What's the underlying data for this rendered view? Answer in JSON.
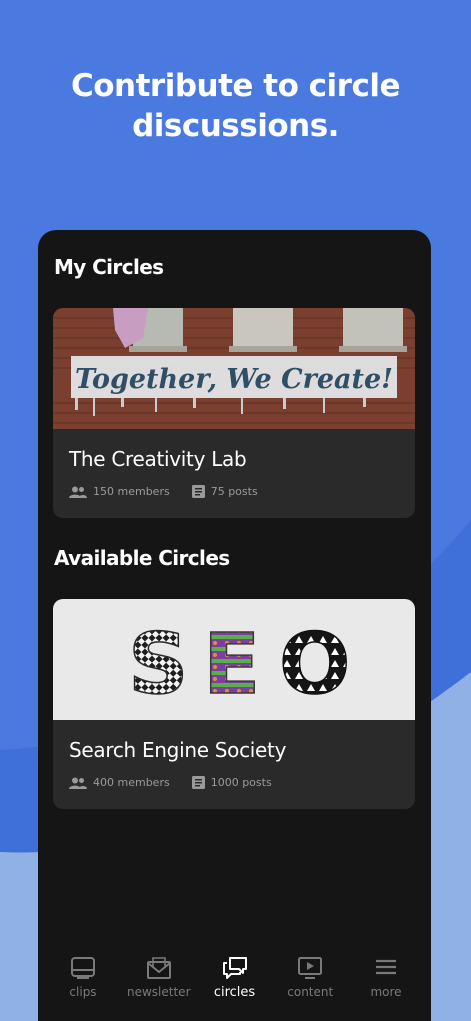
{
  "headline": {
    "line1": "Contribute to circle",
    "line2": "discussions."
  },
  "colors": {
    "background": "#4a7ae0",
    "panel": "#151515",
    "card": "#2a2a2a",
    "muted_text": "#9a9a9a",
    "active_tab": "#ffffff"
  },
  "my_circles": {
    "title": "My Circles",
    "items": [
      {
        "name": "The Creativity Lab",
        "members": "150 members",
        "posts": "75 posts",
        "image_text": "Together, We Create!"
      }
    ]
  },
  "available_circles": {
    "title": "Available Circles",
    "items": [
      {
        "name": "Search Engine Society",
        "members": "400 members",
        "posts": "1000 posts",
        "image_text": "SEO"
      }
    ]
  },
  "tabbar": {
    "active": "circles",
    "tabs": [
      {
        "label": "clips",
        "icon": "clips-icon"
      },
      {
        "label": "newsletter",
        "icon": "envelope-icon"
      },
      {
        "label": "circles",
        "icon": "chat-bubbles-icon"
      },
      {
        "label": "content",
        "icon": "play-screen-icon"
      },
      {
        "label": "more",
        "icon": "hamburger-menu-icon"
      }
    ]
  }
}
